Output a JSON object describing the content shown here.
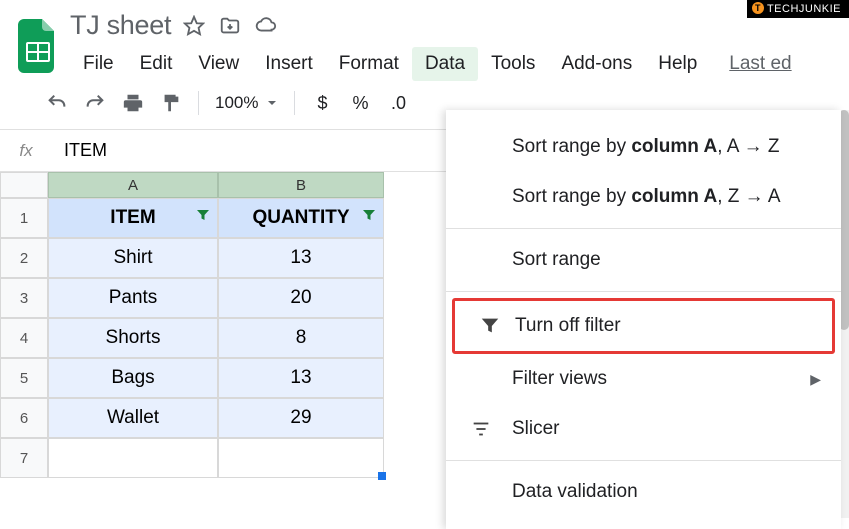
{
  "watermark": {
    "label": "TECHJUNKIE",
    "icon_letter": "T"
  },
  "doc": {
    "title": "TJ sheet"
  },
  "menus": {
    "file": "File",
    "edit": "Edit",
    "view": "View",
    "insert": "Insert",
    "format": "Format",
    "data": "Data",
    "tools": "Tools",
    "addons": "Add-ons",
    "help": "Help",
    "last": "Last ed"
  },
  "toolbar": {
    "zoom": "100%",
    "currency": "$",
    "percent": "%",
    "decimal": ".0"
  },
  "formula_bar": {
    "fx": "fx",
    "value": "ITEM"
  },
  "columns": {
    "a": "A",
    "b": "B"
  },
  "rows": [
    "1",
    "2",
    "3",
    "4",
    "5",
    "6",
    "7"
  ],
  "table": {
    "headers": {
      "item": "ITEM",
      "quantity": "QUANTITY"
    },
    "data": [
      {
        "item": "Shirt",
        "quantity": "13"
      },
      {
        "item": "Pants",
        "quantity": "20"
      },
      {
        "item": "Shorts",
        "quantity": "8"
      },
      {
        "item": "Bags",
        "quantity": "13"
      },
      {
        "item": "Wallet",
        "quantity": "29"
      }
    ]
  },
  "dropdown": {
    "sort_az_pre": "Sort range by ",
    "sort_az_col": "column A",
    "sort_az_suf": ", A → Z",
    "sort_za_pre": "Sort range by ",
    "sort_za_col": "column A",
    "sort_za_suf": ", Z → A",
    "sort_range": "Sort range",
    "turn_off_filter": "Turn off filter",
    "filter_views": "Filter views",
    "slicer": "Slicer",
    "data_validation": "Data validation"
  }
}
